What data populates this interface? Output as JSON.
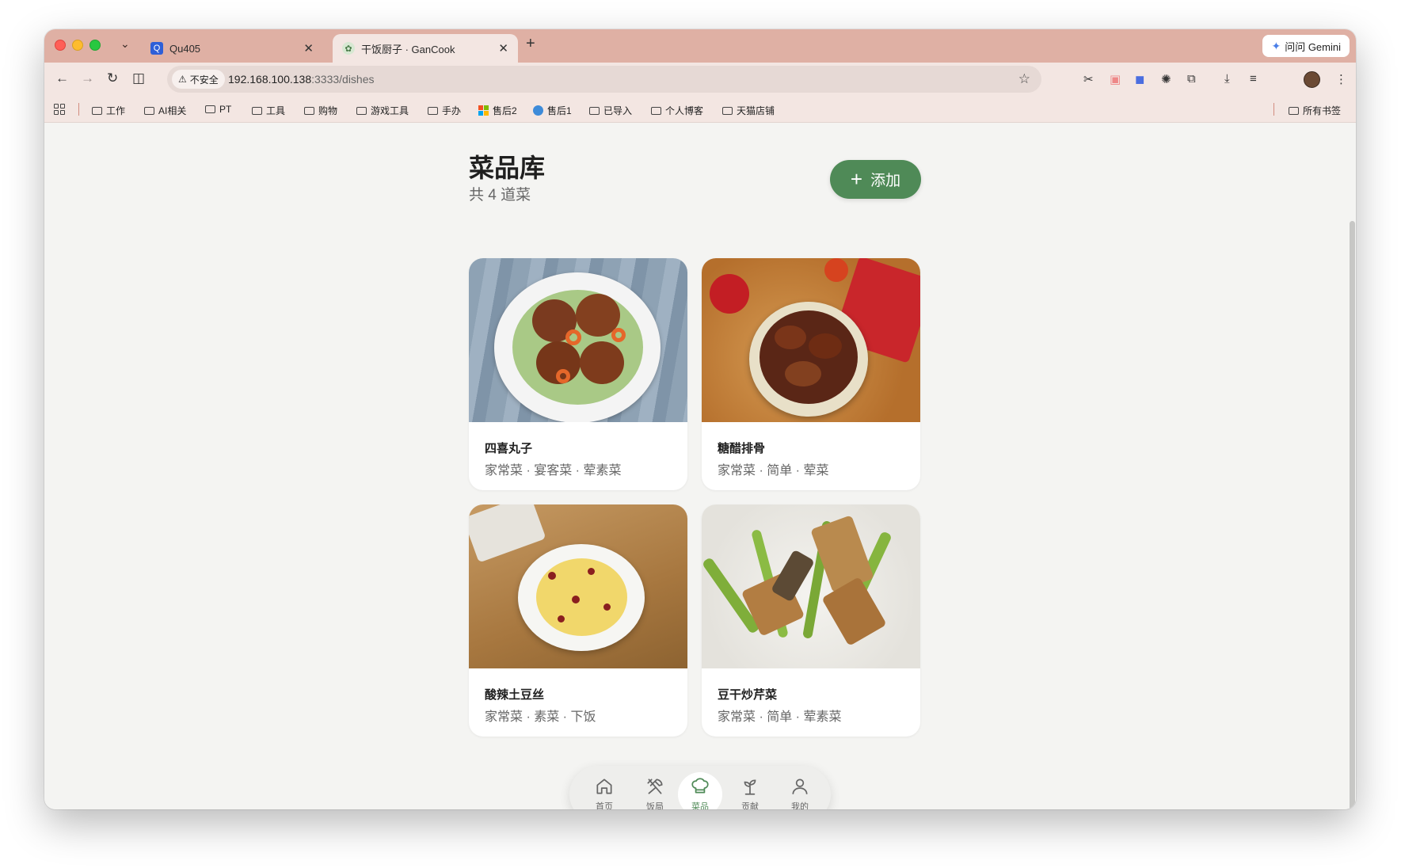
{
  "browser": {
    "tabs": [
      {
        "title": "Qu405",
        "favicon": "Q",
        "active": false
      },
      {
        "title": "干饭厨子 · GanCook",
        "favicon": "✿",
        "active": true
      }
    ],
    "gemini_label": "问问 Gemini",
    "security_label": "不安全",
    "url_host": "192.168.100.138",
    "url_path": ":3333/dishes",
    "bookmarks": [
      "工作",
      "AI相关",
      "PT",
      "工具",
      "购物",
      "游戏工具",
      "手办",
      "售后2",
      "售后1",
      "已导入",
      "个人博客",
      "天猫店铺"
    ],
    "all_bookmarks_label": "所有书签"
  },
  "page": {
    "title": "菜品库",
    "subtitle": "共 4 道菜",
    "add_label": "添加"
  },
  "dishes": [
    {
      "name": "四喜丸子",
      "tags": "家常菜 · 宴客菜 · 荤素菜"
    },
    {
      "name": "糖醋排骨",
      "tags": "家常菜 · 简单 · 荤菜"
    },
    {
      "name": "酸辣土豆丝",
      "tags": "家常菜 · 素菜 · 下饭"
    },
    {
      "name": "豆干炒芹菜",
      "tags": "家常菜 · 简单 · 荤素菜"
    }
  ],
  "bottom_nav": [
    {
      "label": "首页",
      "icon": "home-icon"
    },
    {
      "label": "饭局",
      "icon": "utensils-icon"
    },
    {
      "label": "菜品",
      "icon": "chef-hat-icon",
      "active": true
    },
    {
      "label": "贡献",
      "icon": "sprout-icon"
    },
    {
      "label": "我的",
      "icon": "user-icon"
    }
  ],
  "colors": {
    "accent": "#4f8a57",
    "tab_strip": "#dfb0a4",
    "page_bg": "#f4f4f2"
  }
}
